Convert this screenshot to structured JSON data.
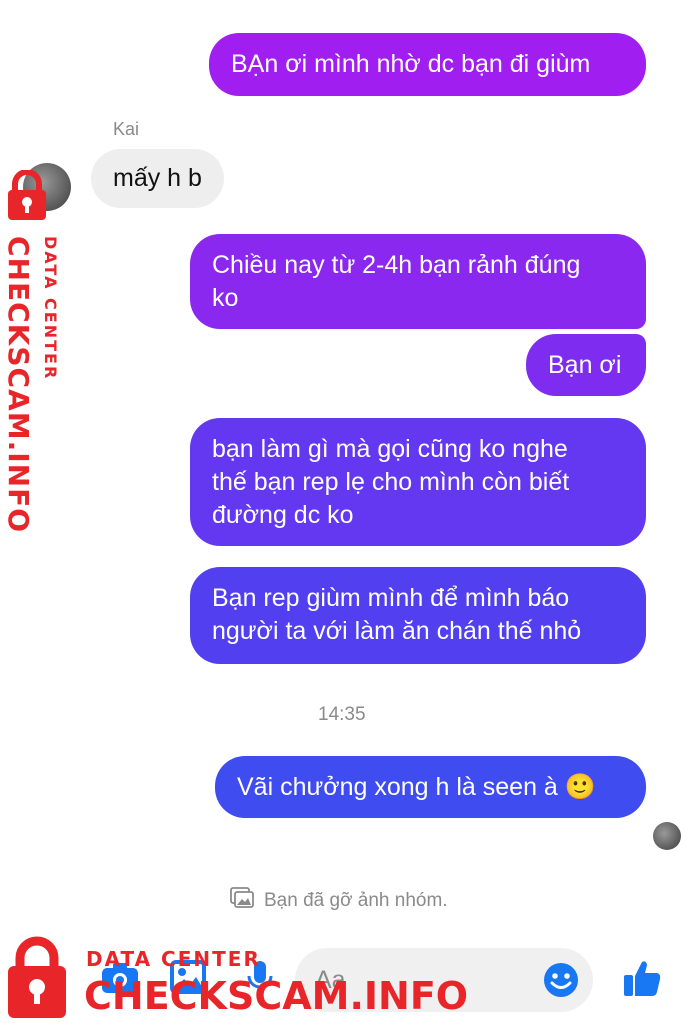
{
  "messages": [
    {
      "text": "BẠn ơi mình nhờ dc bạn đi giùm"
    },
    {
      "sender": "Kai",
      "text": "mấy h b"
    },
    {
      "text": "Chiều nay từ 2-4h bạn rảnh đúng\nko"
    },
    {
      "text": "Bạn ơi"
    },
    {
      "text": "bạn làm gì mà gọi cũng ko nghe\nthế bạn rep lẹ cho mình còn biết\nđường dc ko"
    },
    {
      "text": "Bạn rep giùm mình để mình báo\nngười ta với làm ăn chán thế nhỏ"
    },
    {
      "text": "Vãi chưởng xong h là seen à 🙂"
    }
  ],
  "timestamp": "14:35",
  "notice": "Bạn đã gỡ ảnh nhóm.",
  "composer": {
    "placeholder": "Aa"
  },
  "watermark": {
    "label": "DATA CENTER",
    "site": "CHECKSCAM.INFO"
  },
  "icons": [
    "camera-icon",
    "image-icon",
    "microphone-icon",
    "emoji-icon",
    "like-icon",
    "photo-icon",
    "lock-icon"
  ],
  "colors": {
    "bubble_top": "#a020f0",
    "bubble_bottom": "#3f4cf0",
    "accent": "#1877f2",
    "watermark": "#e8262a"
  }
}
